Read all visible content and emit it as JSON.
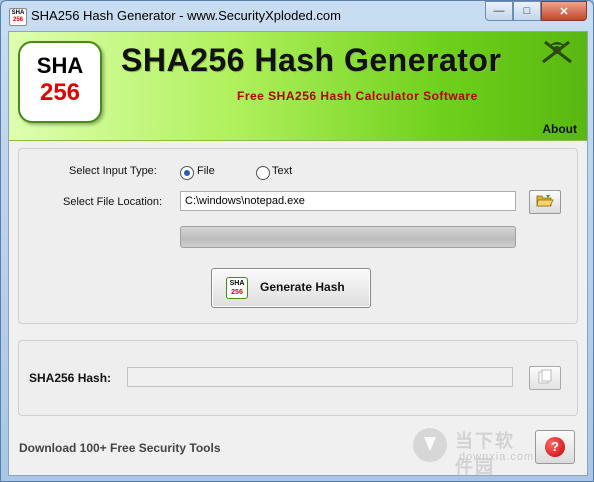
{
  "window": {
    "title": "SHA256 Hash Generator - www.SecurityXploded.com",
    "app_icon_line1": "SHA",
    "app_icon_line2": "256",
    "minimize_glyph": "—",
    "maximize_glyph": "□",
    "close_glyph": "✕"
  },
  "banner": {
    "logo_line1": "SHA",
    "logo_line2": "256",
    "title": "SHA256 Hash Generator",
    "subtitle": "Free SHA256 Hash Calculator Software",
    "about_label": "About",
    "brand_icon": "crossed-swords-icon"
  },
  "input_section": {
    "input_type_label": "Select Input Type:",
    "options": [
      {
        "label": "File",
        "selected": true
      },
      {
        "label": "Text",
        "selected": false
      }
    ],
    "file_location_label": "Select File Location:",
    "file_path": "C:\\windows\\notepad.exe",
    "browse_icon": "folder-open-icon",
    "progress_value": 0
  },
  "generate_button": {
    "label": "Generate Hash",
    "icon_line1": "SHA",
    "icon_line2": "256"
  },
  "output_section": {
    "hash_label": "SHA256 Hash:",
    "hash_value": "",
    "copy_icon": "copy-icon"
  },
  "footer": {
    "link_label": "Download 100+ Free Security Tools",
    "help_icon": "help-icon",
    "help_glyph": "?",
    "watermark_text": "当下软件园",
    "watermark_sub": "downxia.com"
  },
  "colors": {
    "banner_green": "#6fd01c",
    "subtitle_red": "#b30000",
    "logo_red": "#dd0000"
  }
}
